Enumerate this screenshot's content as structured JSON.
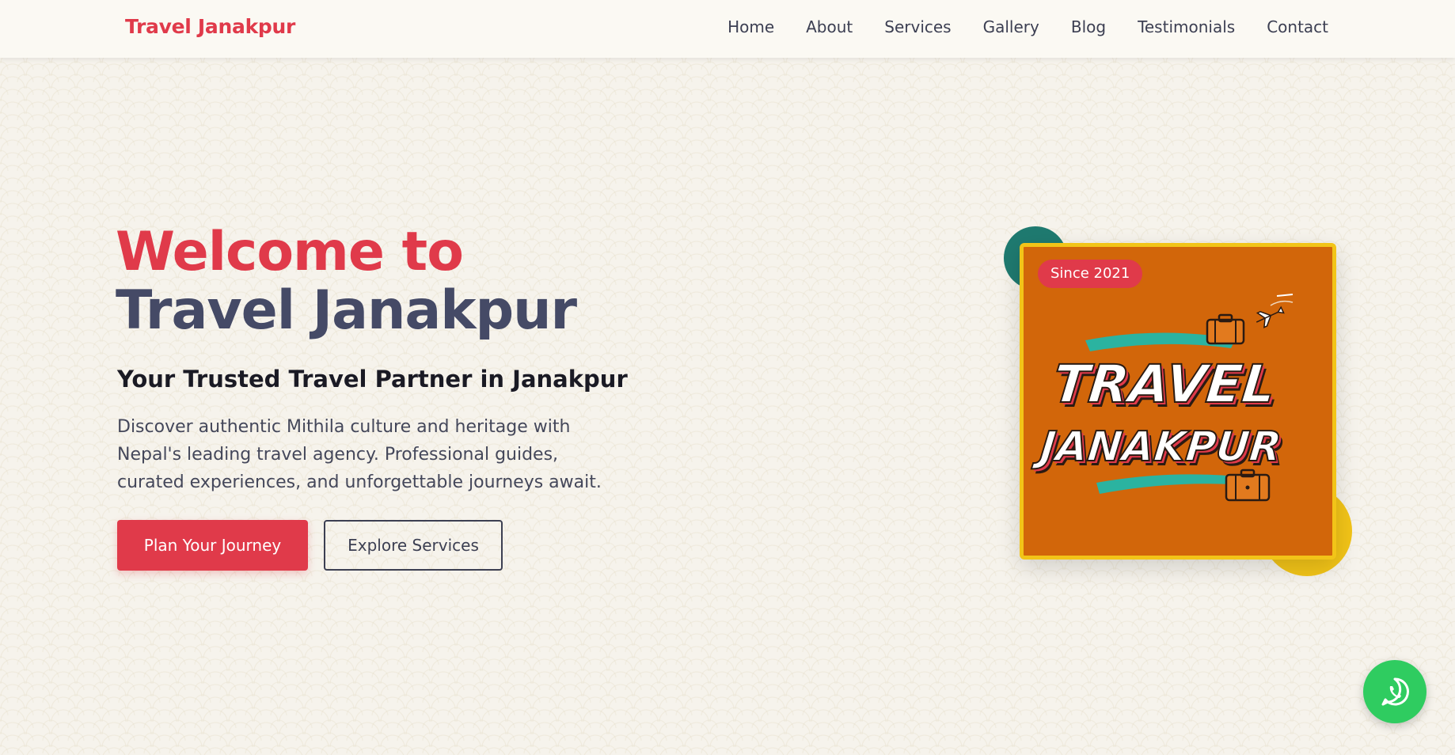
{
  "nav": {
    "brand": "Travel Janakpur",
    "links": [
      "Home",
      "About",
      "Services",
      "Gallery",
      "Blog",
      "Testimonials",
      "Contact"
    ]
  },
  "hero": {
    "title_line1": "Welcome to",
    "title_line2": "Travel Janakpur",
    "subtitle": "Your Trusted Travel Partner in Janakpur",
    "description": "Discover authentic Mithila culture and heritage with Nepal's leading travel agency. Professional guides, curated experiences, and unforgettable journeys await.",
    "primary_button": "Plan Your Journey",
    "secondary_button": "Explore Services"
  },
  "card": {
    "badge": "Since 2021",
    "logo_word1": "TRAVEL",
    "logo_word2": "JANAKPUR"
  },
  "icons": {
    "whatsapp": "whatsapp-icon",
    "suitcase": "suitcase-icon",
    "airplane": "airplane-icon"
  },
  "colors": {
    "brand_red": "#e03a4a",
    "heading_slate": "#454a66",
    "card_orange": "#d2660a",
    "card_border_yellow": "#f2c418",
    "teal": "#1f7a70",
    "whatsapp_green": "#2fcc60"
  }
}
